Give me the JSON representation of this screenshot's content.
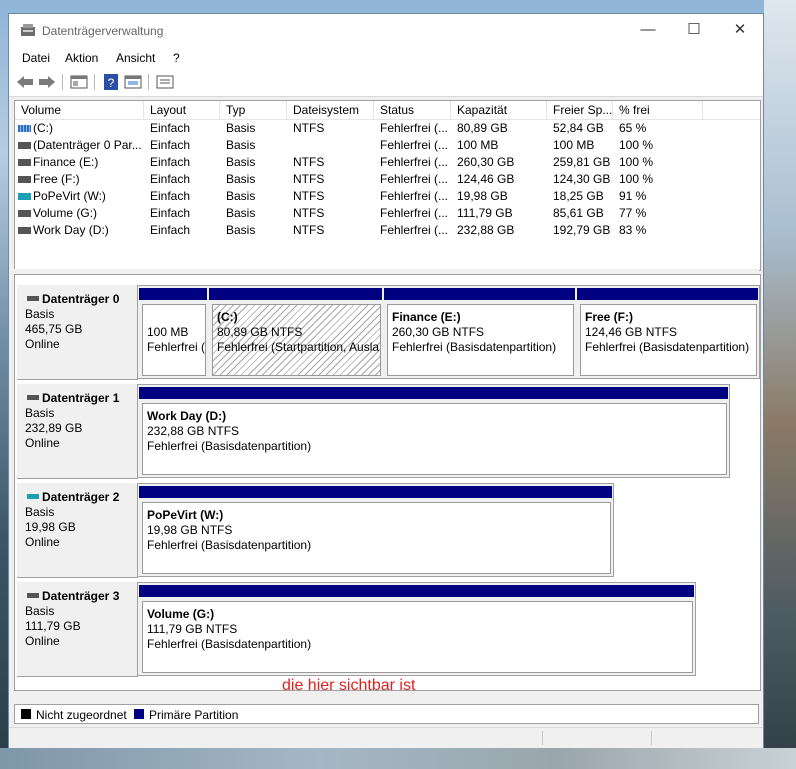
{
  "window": {
    "title": "Datenträgerverwaltung"
  },
  "menu": [
    "Datei",
    "Aktion",
    "Ansicht",
    "?"
  ],
  "toolbar": {
    "icons": [
      "back-arrow-icon",
      "forward-arrow-icon",
      "properties-icon",
      "help-icon",
      "console-icon",
      "list-view-icon"
    ]
  },
  "list": {
    "columns": [
      "Volume",
      "Layout",
      "Typ",
      "Dateisystem",
      "Status",
      "Kapazität",
      "Freier Sp...",
      "% frei"
    ],
    "rows": [
      {
        "volume": "(C:)",
        "layout": "Einfach",
        "typ": "Basis",
        "fs": "NTFS",
        "status": "Fehlerfrei (...",
        "cap": "80,89 GB",
        "free": "52,84 GB",
        "pct": "65 %",
        "icon": "c"
      },
      {
        "volume": "(Datenträger 0 Par...",
        "layout": "Einfach",
        "typ": "Basis",
        "fs": "",
        "status": "Fehlerfrei (...",
        "cap": "100 MB",
        "free": "100 MB",
        "pct": "100 %",
        "icon": "gray"
      },
      {
        "volume": "Finance (E:)",
        "layout": "Einfach",
        "typ": "Basis",
        "fs": "NTFS",
        "status": "Fehlerfrei (...",
        "cap": "260,30 GB",
        "free": "259,81 GB",
        "pct": "100 %",
        "icon": "gray"
      },
      {
        "volume": "Free (F:)",
        "layout": "Einfach",
        "typ": "Basis",
        "fs": "NTFS",
        "status": "Fehlerfrei (...",
        "cap": "124,46 GB",
        "free": "124,30 GB",
        "pct": "100 %",
        "icon": "gray"
      },
      {
        "volume": "PoPeVirt (W:)",
        "layout": "Einfach",
        "typ": "Basis",
        "fs": "NTFS",
        "status": "Fehlerfrei (...",
        "cap": "19,98 GB",
        "free": "18,25 GB",
        "pct": "91 %",
        "icon": "cyan"
      },
      {
        "volume": "Volume (G:)",
        "layout": "Einfach",
        "typ": "Basis",
        "fs": "NTFS",
        "status": "Fehlerfrei (...",
        "cap": "111,79 GB",
        "free": "85,61 GB",
        "pct": "77 %",
        "icon": "gray"
      },
      {
        "volume": "Work Day (D:)",
        "layout": "Einfach",
        "typ": "Basis",
        "fs": "NTFS",
        "status": "Fehlerfrei (...",
        "cap": "232,88 GB",
        "free": "192,79 GB",
        "pct": "83 %",
        "icon": "gray"
      }
    ]
  },
  "disks": [
    {
      "name": "Datenträger 0",
      "type": "Basis",
      "size": "465,75 GB",
      "state": "Online",
      "partitions": [
        {
          "title": "",
          "size": "100 MB",
          "status": "Fehlerfrei (",
          "hatched": false
        },
        {
          "title": "(C:)",
          "size": "80,89 GB NTFS",
          "status": "Fehlerfrei (Startpartition, Ausla",
          "hatched": true
        },
        {
          "title": "Finance  (E:)",
          "size": "260,30 GB NTFS",
          "status": "Fehlerfrei (Basisdatenpartition)",
          "hatched": false
        },
        {
          "title": "Free  (F:)",
          "size": "124,46 GB NTFS",
          "status": "Fehlerfrei (Basisdatenpartition)",
          "hatched": false
        }
      ]
    },
    {
      "name": "Datenträger 1",
      "type": "Basis",
      "size": "232,89 GB",
      "state": "Online",
      "partitions": [
        {
          "title": "Work Day  (D:)",
          "size": "232,88 GB NTFS",
          "status": "Fehlerfrei (Basisdatenpartition)",
          "hatched": false
        }
      ]
    },
    {
      "name": "Datenträger 2",
      "type": "Basis",
      "size": "19,98 GB",
      "state": "Online",
      "partitions": [
        {
          "title": "PoPeVirt  (W:)",
          "size": "19,98 GB NTFS",
          "status": "Fehlerfrei (Basisdatenpartition)",
          "hatched": false
        }
      ]
    },
    {
      "name": "Datenträger 3",
      "type": "Basis",
      "size": "111,79 GB",
      "state": "Online",
      "partitions": [
        {
          "title": "Volume  (G:)",
          "size": "111,79 GB NTFS",
          "status": "Fehlerfrei (Basisdatenpartition)",
          "hatched": false
        }
      ]
    }
  ],
  "annotation": "die hier sichtbar ist",
  "legend": [
    {
      "label": "Nicht zugeordnet",
      "color": "#000000"
    },
    {
      "label": "Primäre Partition",
      "color": "#000080"
    }
  ],
  "colors": {
    "partition_bar": "#000080",
    "annotation": "#e02020"
  }
}
